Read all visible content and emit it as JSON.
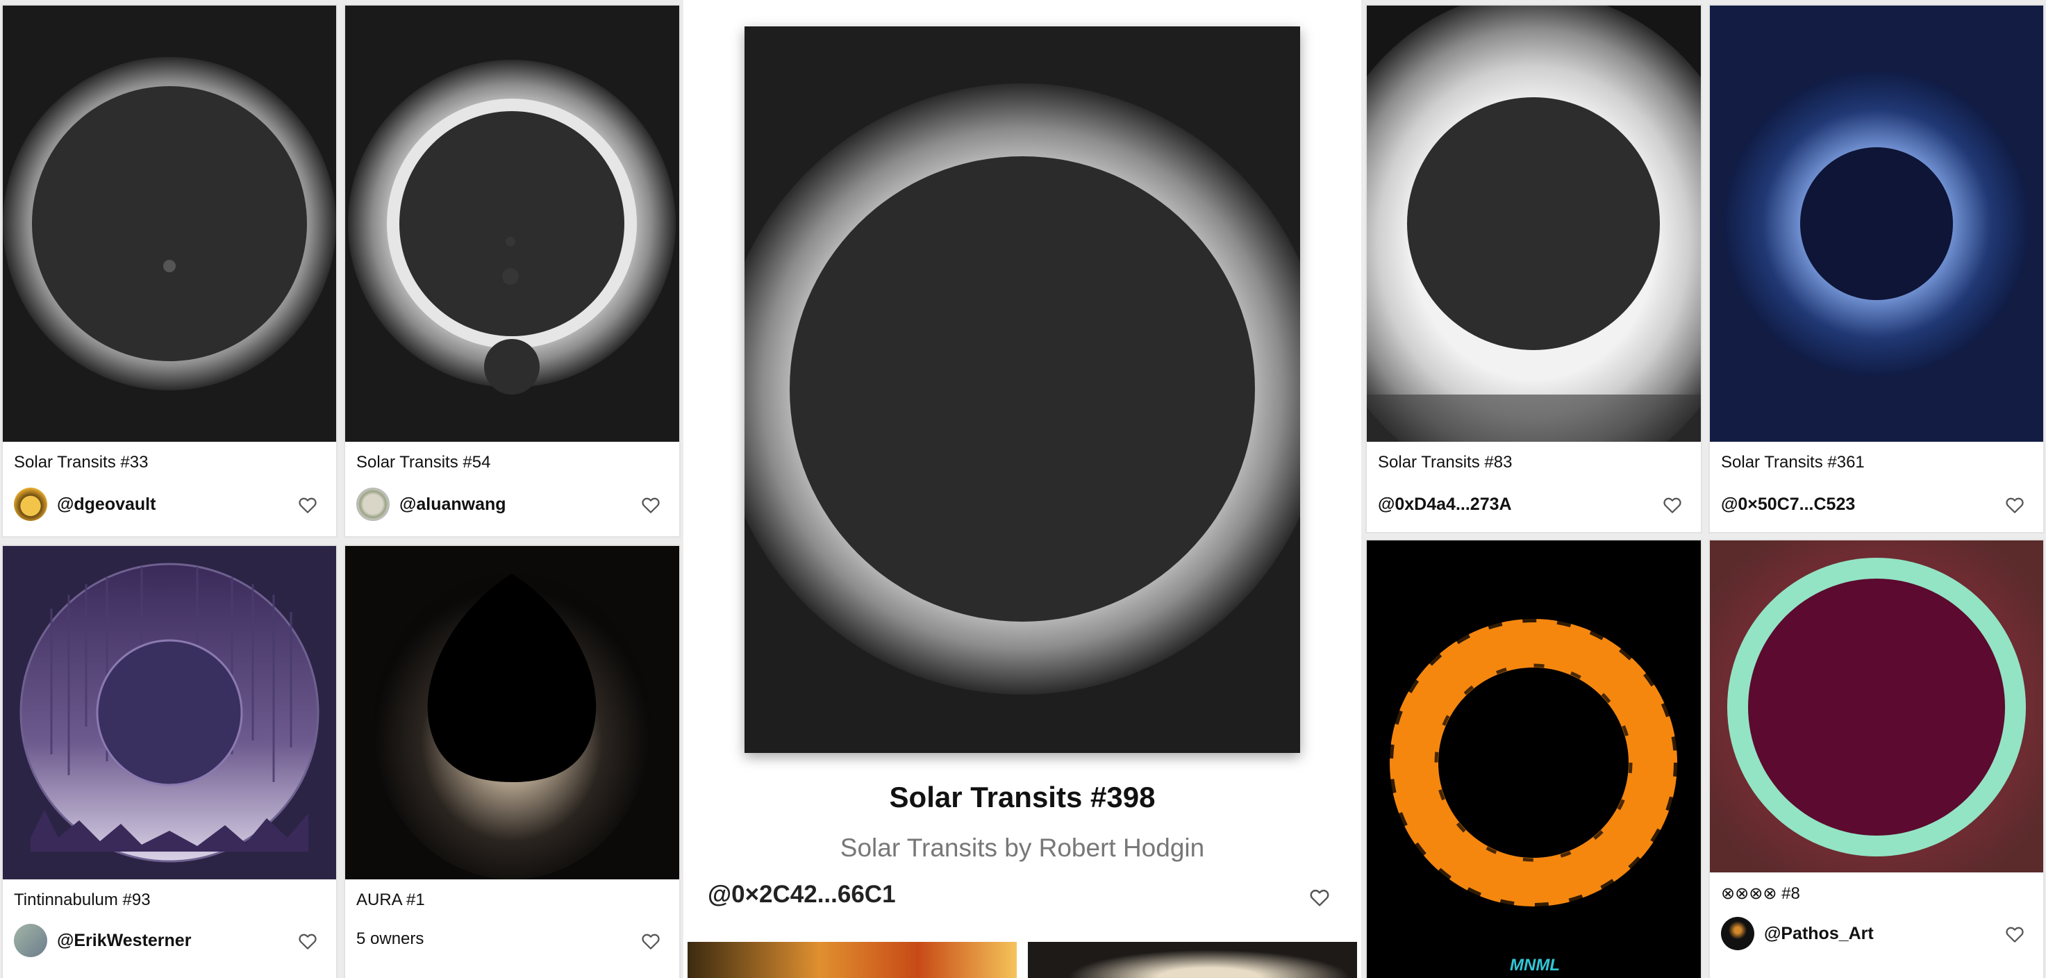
{
  "cards": {
    "c33": {
      "title": "Solar Transits #33",
      "owner": "@dgeovault"
    },
    "c54": {
      "title": "Solar Transits #54",
      "owner": "@aluanwang"
    },
    "c83": {
      "title": "Solar Transits #83",
      "owner": "@0xD4a4...273A"
    },
    "c361": {
      "title": "Solar Transits #361",
      "owner": "@0×50C7...C523"
    },
    "c93": {
      "title": "Tintinnabulum #93",
      "owner": "@ErikWesterner"
    },
    "aura": {
      "title": "AURA #1",
      "owners": "5 owners"
    },
    "mnml": {
      "title": "",
      "watermark": "MNML"
    },
    "pathos": {
      "title": "⊗⊗⊗⊗ #8",
      "owner": "@Pathos_Art"
    }
  },
  "featured": {
    "title": "Solar Transits #398",
    "subtitle": "Solar Transits by Robert Hodgin",
    "owner": "@0×2C42...66C1"
  },
  "icons": {
    "like": "heart-outline-icon"
  }
}
